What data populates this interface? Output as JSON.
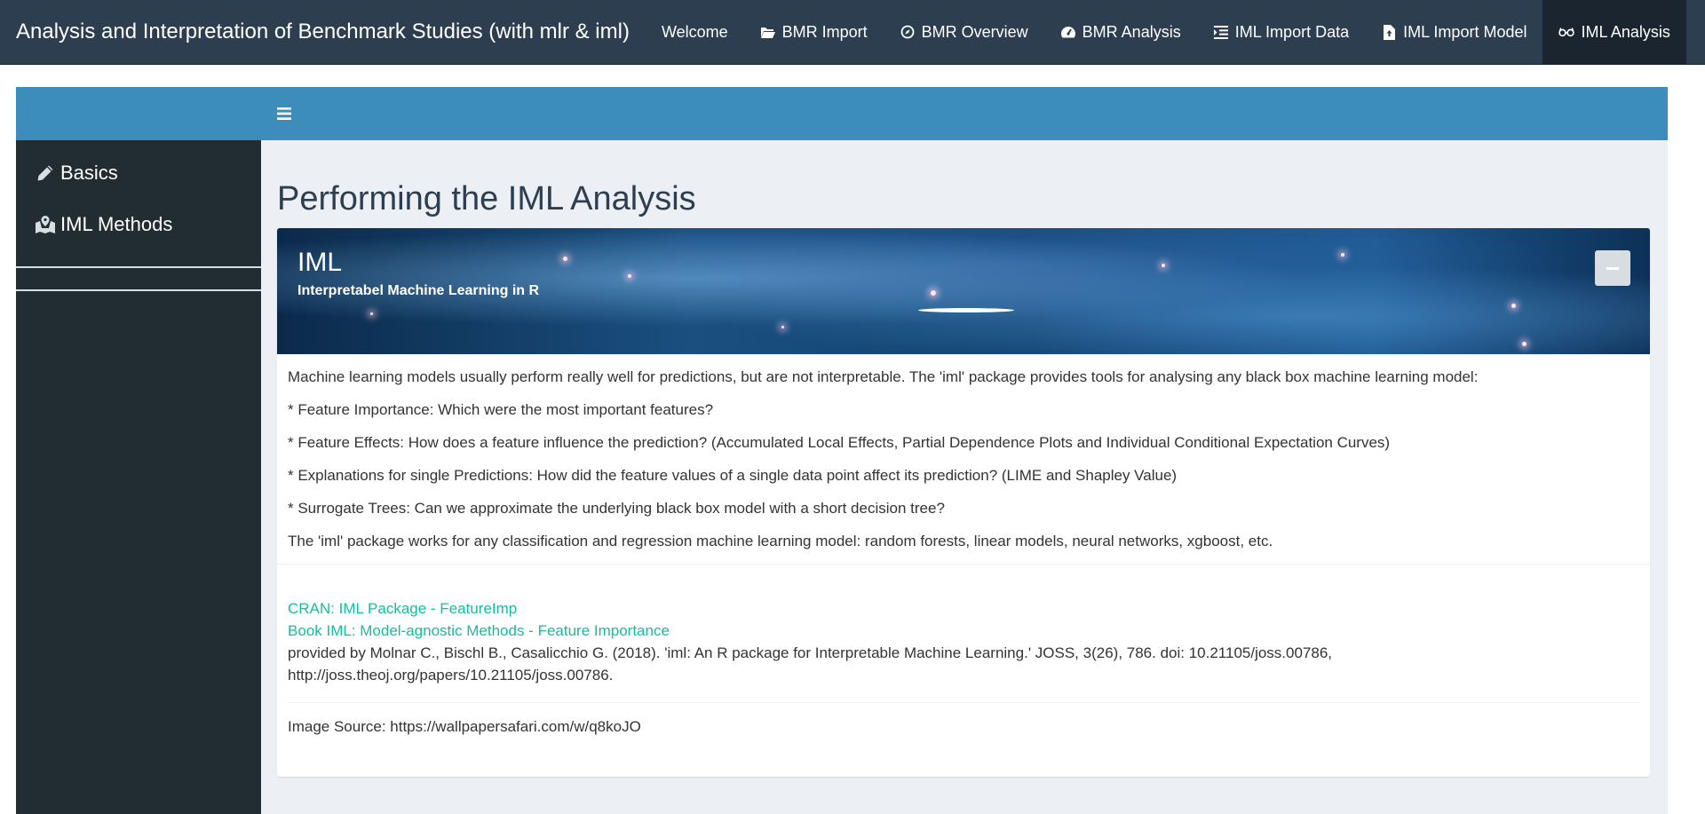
{
  "navbar": {
    "brand": "Analysis and Interpretation of Benchmark Studies (with mlr & iml)",
    "items": [
      {
        "label": "Welcome",
        "icon": "",
        "active": false
      },
      {
        "label": "BMR Import",
        "icon": "folder-open-icon",
        "active": false
      },
      {
        "label": "BMR Overview",
        "icon": "compass-icon",
        "active": false
      },
      {
        "label": "BMR Analysis",
        "icon": "tachometer-icon",
        "active": false
      },
      {
        "label": "IML Import Data",
        "icon": "list-indent-icon",
        "active": false
      },
      {
        "label": "IML Import Model",
        "icon": "file-upload-icon",
        "active": false
      },
      {
        "label": "IML Analysis",
        "icon": "glasses-icon",
        "active": true
      }
    ]
  },
  "sidebar": {
    "items": [
      {
        "label": "Basics",
        "icon": "pencil-icon"
      },
      {
        "label": "IML Methods",
        "icon": "map-marked-icon"
      }
    ]
  },
  "main": {
    "page_title": "Performing the IML Analysis",
    "box": {
      "title": "IML",
      "subtitle": "Interpretabel Machine Learning in R",
      "paragraphs": [
        "Machine learning models usually perform really well for predictions, but are not interpretable. The 'iml' package provides tools for analysing any black box machine learning model:",
        "* Feature Importance: Which were the most important features?",
        "* Feature Effects: How does a feature influence the prediction? (Accumulated Local Effects, Partial Dependence Plots and Individual Conditional Expectation Curves)",
        "* Explanations for single Predictions: How did the feature values of a single data point affect its prediction? (LIME and Shapley Value)",
        "* Surrogate Trees: Can we approximate the underlying black box model with a short decision tree?",
        "The 'iml' package works for any classification and regression machine learning model: random forests, linear models, neural networks, xgboost, etc."
      ],
      "link_cran": "CRAN: IML Package - FeatureImp",
      "link_book": "Book IML: Model-agnostic Methods - Feature Importance",
      "citation": "provided by Molnar C., Bischl B., Casalicchio G. (2018). 'iml: An R package for Interpretable Machine Learning.' JOSS, 3(26), 786. doi: 10.21105/joss.00786, http://joss.theoj.org/papers/10.21105/joss.00786.",
      "image_source": "Image Source: https://wallpapersafari.com/w/q8koJO"
    }
  },
  "colors": {
    "navbar": "#2c3e50",
    "header_blue": "#3c8dbc",
    "sidebar": "#222d32",
    "content_bg": "#ecf0f5",
    "link": "#18bc9c"
  }
}
